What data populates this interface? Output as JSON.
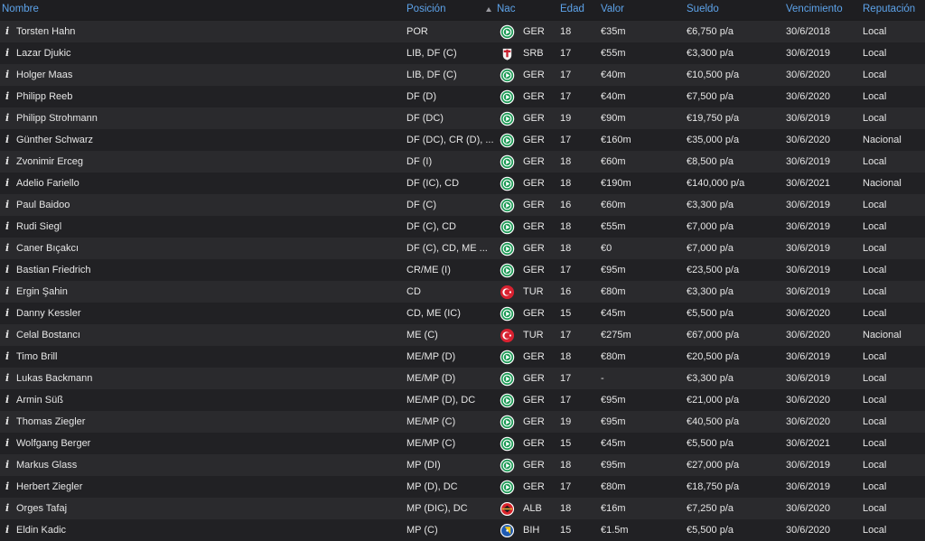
{
  "columns": {
    "name": "Nombre",
    "position": "Posición",
    "nat": "Nac",
    "age": "Edad",
    "value": "Valor",
    "wage": "Sueldo",
    "expiry": "Vencimiento",
    "reputation": "Reputación"
  },
  "info_glyph": "i",
  "flag_icons": {
    "GER": "germany-federation-crest-icon",
    "SRB": "serbia-federation-crest-icon",
    "TUR": "turkey-federation-crest-icon",
    "ALB": "albania-federation-crest-icon",
    "BIH": "bosnia-federation-crest-icon"
  },
  "colors": {
    "header_text": "#5da3ea",
    "background": "#1c1c1e",
    "row_odd": "#2a2a2d",
    "row_even": "#212124",
    "text": "#e6e6e6"
  },
  "players": [
    {
      "name": "Torsten Hahn",
      "position": "POR",
      "nat": "GER",
      "age": "18",
      "value": "€35m",
      "wage": "€6,750 p/a",
      "expiry": "30/6/2018",
      "reputation": "Local"
    },
    {
      "name": "Lazar Djukic",
      "position": "LIB, DF (C)",
      "nat": "SRB",
      "age": "17",
      "value": "€55m",
      "wage": "€3,300 p/a",
      "expiry": "30/6/2019",
      "reputation": "Local"
    },
    {
      "name": "Holger Maas",
      "position": "LIB, DF (C)",
      "nat": "GER",
      "age": "17",
      "value": "€40m",
      "wage": "€10,500 p/a",
      "expiry": "30/6/2020",
      "reputation": "Local"
    },
    {
      "name": "Philipp Reeb",
      "position": "DF (D)",
      "nat": "GER",
      "age": "17",
      "value": "€40m",
      "wage": "€7,500 p/a",
      "expiry": "30/6/2020",
      "reputation": "Local"
    },
    {
      "name": "Philipp Strohmann",
      "position": "DF (DC)",
      "nat": "GER",
      "age": "19",
      "value": "€90m",
      "wage": "€19,750 p/a",
      "expiry": "30/6/2019",
      "reputation": "Local"
    },
    {
      "name": "Günther Schwarz",
      "position": "DF (DC), CR (D), ...",
      "nat": "GER",
      "age": "17",
      "value": "€160m",
      "wage": "€35,000 p/a",
      "expiry": "30/6/2020",
      "reputation": "Nacional"
    },
    {
      "name": "Zvonimir Erceg",
      "position": "DF (I)",
      "nat": "GER",
      "age": "18",
      "value": "€60m",
      "wage": "€8,500 p/a",
      "expiry": "30/6/2019",
      "reputation": "Local"
    },
    {
      "name": "Adelio Fariello",
      "position": "DF (IC), CD",
      "nat": "GER",
      "age": "18",
      "value": "€190m",
      "wage": "€140,000 p/a",
      "expiry": "30/6/2021",
      "reputation": "Nacional"
    },
    {
      "name": "Paul Baidoo",
      "position": "DF (C)",
      "nat": "GER",
      "age": "16",
      "value": "€60m",
      "wage": "€3,300 p/a",
      "expiry": "30/6/2019",
      "reputation": "Local"
    },
    {
      "name": "Rudi Siegl",
      "position": "DF (C), CD",
      "nat": "GER",
      "age": "18",
      "value": "€55m",
      "wage": "€7,000 p/a",
      "expiry": "30/6/2019",
      "reputation": "Local"
    },
    {
      "name": "Caner Bıçakcı",
      "position": "DF (C), CD, ME ...",
      "nat": "GER",
      "age": "18",
      "value": "€0",
      "wage": "€7,000 p/a",
      "expiry": "30/6/2019",
      "reputation": "Local"
    },
    {
      "name": "Bastian Friedrich",
      "position": "CR/ME (I)",
      "nat": "GER",
      "age": "17",
      "value": "€95m",
      "wage": "€23,500 p/a",
      "expiry": "30/6/2019",
      "reputation": "Local"
    },
    {
      "name": "Ergin Şahin",
      "position": "CD",
      "nat": "TUR",
      "age": "16",
      "value": "€80m",
      "wage": "€3,300 p/a",
      "expiry": "30/6/2019",
      "reputation": "Local"
    },
    {
      "name": "Danny Kessler",
      "position": "CD, ME (IC)",
      "nat": "GER",
      "age": "15",
      "value": "€45m",
      "wage": "€5,500 p/a",
      "expiry": "30/6/2020",
      "reputation": "Local"
    },
    {
      "name": "Celal Bostancı",
      "position": "ME (C)",
      "nat": "TUR",
      "age": "17",
      "value": "€275m",
      "wage": "€67,000 p/a",
      "expiry": "30/6/2020",
      "reputation": "Nacional"
    },
    {
      "name": "Timo Brill",
      "position": "ME/MP (D)",
      "nat": "GER",
      "age": "18",
      "value": "€80m",
      "wage": "€20,500 p/a",
      "expiry": "30/6/2019",
      "reputation": "Local"
    },
    {
      "name": "Lukas Backmann",
      "position": "ME/MP (D)",
      "nat": "GER",
      "age": "17",
      "value": "-",
      "wage": "€3,300 p/a",
      "expiry": "30/6/2019",
      "reputation": "Local"
    },
    {
      "name": "Armin Süß",
      "position": "ME/MP (D), DC",
      "nat": "GER",
      "age": "17",
      "value": "€95m",
      "wage": "€21,000 p/a",
      "expiry": "30/6/2020",
      "reputation": "Local"
    },
    {
      "name": "Thomas Ziegler",
      "position": "ME/MP (C)",
      "nat": "GER",
      "age": "19",
      "value": "€95m",
      "wage": "€40,500 p/a",
      "expiry": "30/6/2020",
      "reputation": "Local"
    },
    {
      "name": "Wolfgang Berger",
      "position": "ME/MP (C)",
      "nat": "GER",
      "age": "15",
      "value": "€45m",
      "wage": "€5,500 p/a",
      "expiry": "30/6/2021",
      "reputation": "Local"
    },
    {
      "name": "Markus Glass",
      "position": "MP (DI)",
      "nat": "GER",
      "age": "18",
      "value": "€95m",
      "wage": "€27,000 p/a",
      "expiry": "30/6/2019",
      "reputation": "Local"
    },
    {
      "name": "Herbert Ziegler",
      "position": "MP (D), DC",
      "nat": "GER",
      "age": "17",
      "value": "€80m",
      "wage": "€18,750 p/a",
      "expiry": "30/6/2019",
      "reputation": "Local"
    },
    {
      "name": "Orges Tafaj",
      "position": "MP (DIC), DC",
      "nat": "ALB",
      "age": "18",
      "value": "€16m",
      "wage": "€7,250 p/a",
      "expiry": "30/6/2020",
      "reputation": "Local"
    },
    {
      "name": "Eldin Kadic",
      "position": "MP (C)",
      "nat": "BIH",
      "age": "15",
      "value": "€1.5m",
      "wage": "€5,500 p/a",
      "expiry": "30/6/2020",
      "reputation": "Local"
    }
  ]
}
